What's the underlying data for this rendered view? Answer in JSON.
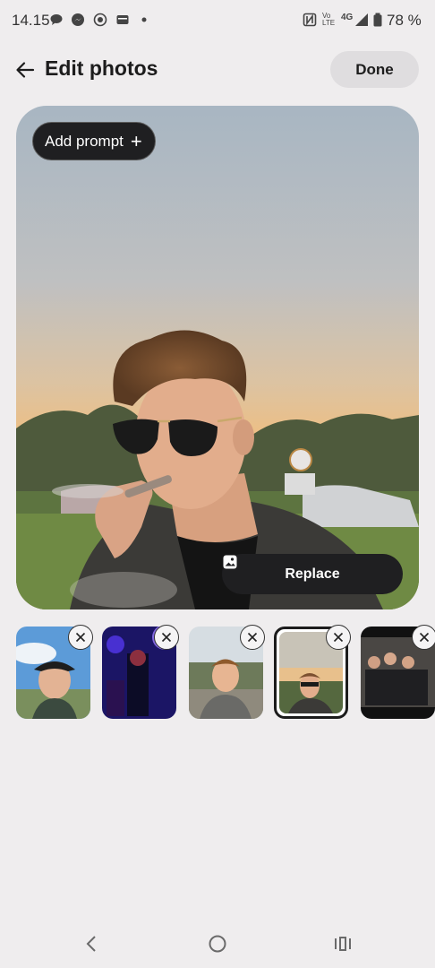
{
  "status_bar": {
    "time": "14.15",
    "notification_icons": [
      "chat-bubble-icon",
      "messenger-icon",
      "signal-app-icon",
      "wallet-icon",
      "dot-icon"
    ],
    "system_icons": [
      "nfc-icon",
      "volte-icon",
      "network-4g-icon",
      "signal-strength-icon",
      "battery-icon"
    ],
    "volte_label": "Vo LTE",
    "network_label": "4G",
    "battery": "78 %"
  },
  "header": {
    "title": "Edit photos",
    "done_label": "Done"
  },
  "main_photo": {
    "add_prompt_label": "Add prompt",
    "add_prompt_icon": "plus-icon",
    "replace_label": "Replace",
    "replace_icon": "image-icon"
  },
  "thumbnails": [
    {
      "remove_icon": "close-icon",
      "selected": false
    },
    {
      "remove_icon": "close-icon",
      "selected": false
    },
    {
      "remove_icon": "close-icon",
      "selected": false
    },
    {
      "remove_icon": "close-icon",
      "selected": true
    },
    {
      "remove_icon": "close-icon",
      "selected": false
    }
  ],
  "navigation": {
    "back_icon": "chevron-left-icon",
    "home_icon": "circle-home-icon",
    "recents_icon": "recents-icon"
  }
}
